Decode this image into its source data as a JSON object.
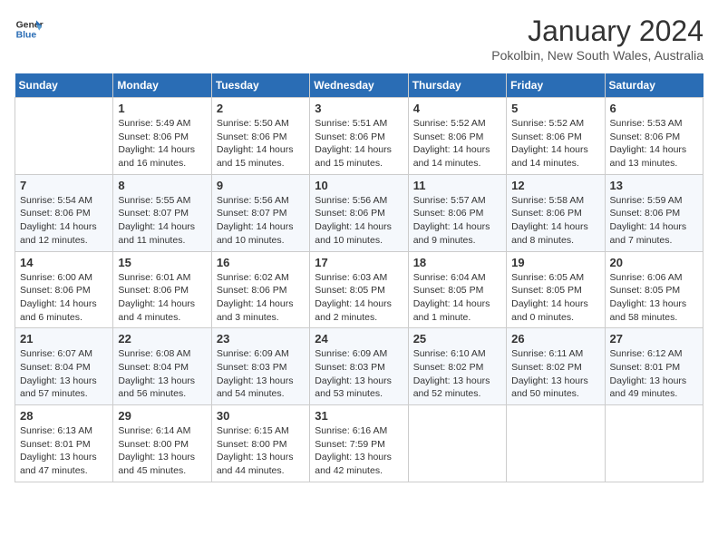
{
  "logo": {
    "line1": "General",
    "line2": "Blue"
  },
  "title": "January 2024",
  "location": "Pokolbin, New South Wales, Australia",
  "days_of_week": [
    "Sunday",
    "Monday",
    "Tuesday",
    "Wednesday",
    "Thursday",
    "Friday",
    "Saturday"
  ],
  "weeks": [
    [
      {
        "day": "",
        "sunrise": "",
        "sunset": "",
        "daylight": ""
      },
      {
        "day": "1",
        "sunrise": "Sunrise: 5:49 AM",
        "sunset": "Sunset: 8:06 PM",
        "daylight": "Daylight: 14 hours and 16 minutes."
      },
      {
        "day": "2",
        "sunrise": "Sunrise: 5:50 AM",
        "sunset": "Sunset: 8:06 PM",
        "daylight": "Daylight: 14 hours and 15 minutes."
      },
      {
        "day": "3",
        "sunrise": "Sunrise: 5:51 AM",
        "sunset": "Sunset: 8:06 PM",
        "daylight": "Daylight: 14 hours and 15 minutes."
      },
      {
        "day": "4",
        "sunrise": "Sunrise: 5:52 AM",
        "sunset": "Sunset: 8:06 PM",
        "daylight": "Daylight: 14 hours and 14 minutes."
      },
      {
        "day": "5",
        "sunrise": "Sunrise: 5:52 AM",
        "sunset": "Sunset: 8:06 PM",
        "daylight": "Daylight: 14 hours and 14 minutes."
      },
      {
        "day": "6",
        "sunrise": "Sunrise: 5:53 AM",
        "sunset": "Sunset: 8:06 PM",
        "daylight": "Daylight: 14 hours and 13 minutes."
      }
    ],
    [
      {
        "day": "7",
        "sunrise": "Sunrise: 5:54 AM",
        "sunset": "Sunset: 8:06 PM",
        "daylight": "Daylight: 14 hours and 12 minutes."
      },
      {
        "day": "8",
        "sunrise": "Sunrise: 5:55 AM",
        "sunset": "Sunset: 8:07 PM",
        "daylight": "Daylight: 14 hours and 11 minutes."
      },
      {
        "day": "9",
        "sunrise": "Sunrise: 5:56 AM",
        "sunset": "Sunset: 8:07 PM",
        "daylight": "Daylight: 14 hours and 10 minutes."
      },
      {
        "day": "10",
        "sunrise": "Sunrise: 5:56 AM",
        "sunset": "Sunset: 8:06 PM",
        "daylight": "Daylight: 14 hours and 10 minutes."
      },
      {
        "day": "11",
        "sunrise": "Sunrise: 5:57 AM",
        "sunset": "Sunset: 8:06 PM",
        "daylight": "Daylight: 14 hours and 9 minutes."
      },
      {
        "day": "12",
        "sunrise": "Sunrise: 5:58 AM",
        "sunset": "Sunset: 8:06 PM",
        "daylight": "Daylight: 14 hours and 8 minutes."
      },
      {
        "day": "13",
        "sunrise": "Sunrise: 5:59 AM",
        "sunset": "Sunset: 8:06 PM",
        "daylight": "Daylight: 14 hours and 7 minutes."
      }
    ],
    [
      {
        "day": "14",
        "sunrise": "Sunrise: 6:00 AM",
        "sunset": "Sunset: 8:06 PM",
        "daylight": "Daylight: 14 hours and 6 minutes."
      },
      {
        "day": "15",
        "sunrise": "Sunrise: 6:01 AM",
        "sunset": "Sunset: 8:06 PM",
        "daylight": "Daylight: 14 hours and 4 minutes."
      },
      {
        "day": "16",
        "sunrise": "Sunrise: 6:02 AM",
        "sunset": "Sunset: 8:06 PM",
        "daylight": "Daylight: 14 hours and 3 minutes."
      },
      {
        "day": "17",
        "sunrise": "Sunrise: 6:03 AM",
        "sunset": "Sunset: 8:05 PM",
        "daylight": "Daylight: 14 hours and 2 minutes."
      },
      {
        "day": "18",
        "sunrise": "Sunrise: 6:04 AM",
        "sunset": "Sunset: 8:05 PM",
        "daylight": "Daylight: 14 hours and 1 minute."
      },
      {
        "day": "19",
        "sunrise": "Sunrise: 6:05 AM",
        "sunset": "Sunset: 8:05 PM",
        "daylight": "Daylight: 14 hours and 0 minutes."
      },
      {
        "day": "20",
        "sunrise": "Sunrise: 6:06 AM",
        "sunset": "Sunset: 8:05 PM",
        "daylight": "Daylight: 13 hours and 58 minutes."
      }
    ],
    [
      {
        "day": "21",
        "sunrise": "Sunrise: 6:07 AM",
        "sunset": "Sunset: 8:04 PM",
        "daylight": "Daylight: 13 hours and 57 minutes."
      },
      {
        "day": "22",
        "sunrise": "Sunrise: 6:08 AM",
        "sunset": "Sunset: 8:04 PM",
        "daylight": "Daylight: 13 hours and 56 minutes."
      },
      {
        "day": "23",
        "sunrise": "Sunrise: 6:09 AM",
        "sunset": "Sunset: 8:03 PM",
        "daylight": "Daylight: 13 hours and 54 minutes."
      },
      {
        "day": "24",
        "sunrise": "Sunrise: 6:09 AM",
        "sunset": "Sunset: 8:03 PM",
        "daylight": "Daylight: 13 hours and 53 minutes."
      },
      {
        "day": "25",
        "sunrise": "Sunrise: 6:10 AM",
        "sunset": "Sunset: 8:02 PM",
        "daylight": "Daylight: 13 hours and 52 minutes."
      },
      {
        "day": "26",
        "sunrise": "Sunrise: 6:11 AM",
        "sunset": "Sunset: 8:02 PM",
        "daylight": "Daylight: 13 hours and 50 minutes."
      },
      {
        "day": "27",
        "sunrise": "Sunrise: 6:12 AM",
        "sunset": "Sunset: 8:01 PM",
        "daylight": "Daylight: 13 hours and 49 minutes."
      }
    ],
    [
      {
        "day": "28",
        "sunrise": "Sunrise: 6:13 AM",
        "sunset": "Sunset: 8:01 PM",
        "daylight": "Daylight: 13 hours and 47 minutes."
      },
      {
        "day": "29",
        "sunrise": "Sunrise: 6:14 AM",
        "sunset": "Sunset: 8:00 PM",
        "daylight": "Daylight: 13 hours and 45 minutes."
      },
      {
        "day": "30",
        "sunrise": "Sunrise: 6:15 AM",
        "sunset": "Sunset: 8:00 PM",
        "daylight": "Daylight: 13 hours and 44 minutes."
      },
      {
        "day": "31",
        "sunrise": "Sunrise: 6:16 AM",
        "sunset": "Sunset: 7:59 PM",
        "daylight": "Daylight: 13 hours and 42 minutes."
      },
      {
        "day": "",
        "sunrise": "",
        "sunset": "",
        "daylight": ""
      },
      {
        "day": "",
        "sunrise": "",
        "sunset": "",
        "daylight": ""
      },
      {
        "day": "",
        "sunrise": "",
        "sunset": "",
        "daylight": ""
      }
    ]
  ]
}
